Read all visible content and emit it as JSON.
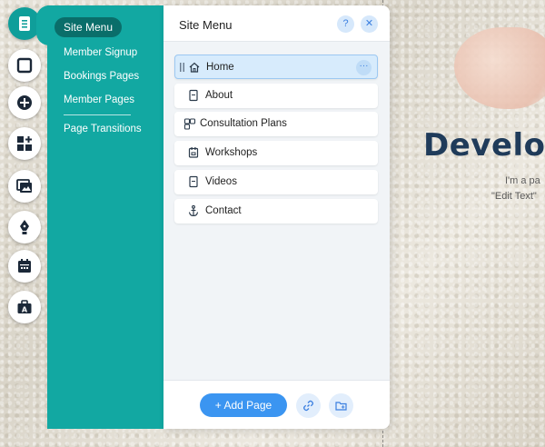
{
  "site_hero": {
    "title": "Develop",
    "line1": "I'm a pa",
    "line2": "\"Edit Text\""
  },
  "toolbar": {
    "tools": [
      {
        "name": "pages-icon",
        "active": true
      },
      {
        "name": "background-icon"
      },
      {
        "name": "add-icon"
      },
      {
        "name": "app-market-icon"
      },
      {
        "name": "media-icon"
      },
      {
        "name": "blog-pen-icon"
      },
      {
        "name": "bookings-calendar-icon"
      },
      {
        "name": "business-briefcase-icon"
      }
    ]
  },
  "submenu": {
    "active": "Site Menu",
    "items": [
      "Member Signup",
      "Bookings Pages",
      "Member Pages"
    ],
    "footer_item": "Page Transitions"
  },
  "site_menu": {
    "title": "Site Menu",
    "help_label": "?",
    "close_label": "✕",
    "pages": [
      {
        "label": "Home",
        "icon": "home-icon",
        "selected": true
      },
      {
        "label": "About",
        "icon": "page-icon"
      },
      {
        "label": "Consultation Plans",
        "icon": "plans-icon"
      },
      {
        "label": "Workshops",
        "icon": "calendar-page-icon"
      },
      {
        "label": "Videos",
        "icon": "page-icon"
      },
      {
        "label": "Contact",
        "icon": "anchor-icon"
      }
    ],
    "more_label": "···",
    "add_page_label": "+ Add Page"
  },
  "colors": {
    "teal": "#12a8a2",
    "teal_dark": "#0a6e6a",
    "accent_blue": "#3b95f1",
    "hero_navy": "#1f3b5a"
  }
}
